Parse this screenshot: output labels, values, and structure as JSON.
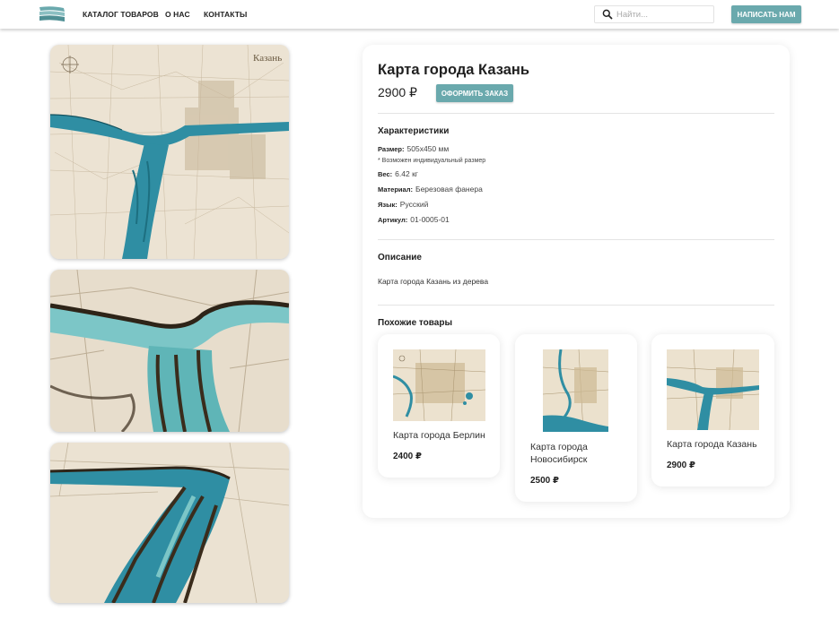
{
  "nav": {
    "catalog": "КАТАЛОГ ТОВАРОВ",
    "about": "О НАС",
    "contacts": "КОНТАКТЫ"
  },
  "search": {
    "placeholder": "Найти..."
  },
  "header": {
    "contact_button": "НАПИСАТЬ НАМ"
  },
  "gallery": {
    "map_label": "Казань"
  },
  "product": {
    "title": "Карта города Казань",
    "price": "2900 ₽",
    "order_button": "ОФОРМИТЬ ЗАКАЗ",
    "specs_title": "Характеристики",
    "specs": {
      "size_label": "Размер:",
      "size_value": "505x450 мм",
      "size_note": "* Возможен индивидуальный размер",
      "weight_label": "Вес:",
      "weight_value": "6.42 кг",
      "material_label": "Материал:",
      "material_value": "Березовая фанера",
      "language_label": "Язык:",
      "language_value": "Русский",
      "sku_label": "Артикул:",
      "sku_value": "01-0005-01"
    },
    "description_title": "Описание",
    "description": "Карта города Казань из дерева"
  },
  "similar": {
    "title": "Похожие товары",
    "items": [
      {
        "name": "Карта города Берлин",
        "price": "2400 ₽"
      },
      {
        "name": "Карта города Новосибирск",
        "price": "2500 ₽"
      },
      {
        "name": "Карта города Казань",
        "price": "2900 ₽"
      }
    ]
  },
  "colors": {
    "accent": "#6aa9ad",
    "water": "#2f8ea3",
    "wood": "#efe6d6"
  }
}
